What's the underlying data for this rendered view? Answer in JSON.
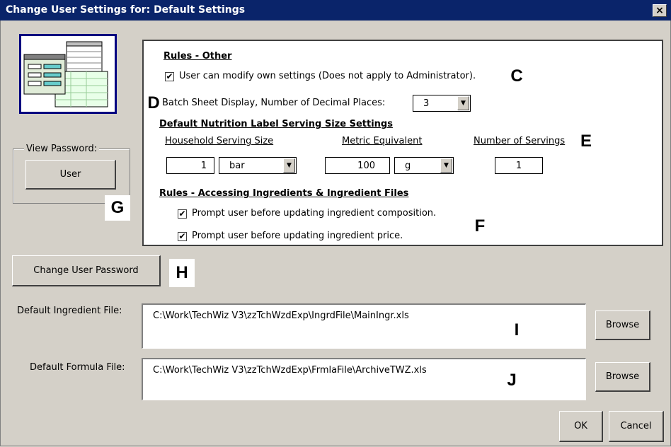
{
  "window": {
    "title": "Change User Settings for: Default Settings",
    "close_glyph": "×"
  },
  "view_password": {
    "label": "View Password:",
    "button": "User"
  },
  "rules_other": {
    "heading": "Rules - Other",
    "modify_settings_label": "User can modify own settings (Does not apply to Administrator).",
    "modify_settings_checked": true,
    "decimal_label": "Batch Sheet Display, Number of Decimal Places:",
    "decimal_value": "3"
  },
  "nutrition": {
    "heading": "Default Nutrition Label Serving Size Settings",
    "household_header": "Household Serving Size",
    "metric_header": "Metric Equivalent",
    "servings_header": "Number of Servings",
    "household_qty": "1",
    "household_unit": "bar",
    "metric_qty": "100",
    "metric_unit": "g",
    "servings": "1"
  },
  "ingredient_rules": {
    "heading": "Rules - Accessing Ingredients & Ingredient Files",
    "prompt_composition_label": "Prompt user before updating ingredient composition.",
    "prompt_composition_checked": true,
    "prompt_price_label": "Prompt user before updating ingredient price.",
    "prompt_price_checked": true
  },
  "change_password_button": "Change User Password",
  "files": {
    "ingredient_label": "Default Ingredient File:",
    "ingredient_path": "C:\\Work\\TechWiz V3\\zzTchWzdExp\\IngrdFile\\MainIngr.xls",
    "formula_label": "Default Formula File:",
    "formula_path": "C:\\Work\\TechWiz V3\\zzTchWzdExp\\FrmlaFile\\ArchiveTWZ.xls",
    "browse": "Browse"
  },
  "buttons": {
    "ok": "OK",
    "cancel": "Cancel"
  },
  "markers": {
    "c": "C",
    "d": "D",
    "e": "E",
    "f": "F",
    "g": "G",
    "h": "H",
    "i": "I",
    "j": "J"
  },
  "check_glyph": "✔",
  "arrow_glyph": "▼",
  "colors": {
    "titlebar": "#0a246a",
    "window": "#d4d0c8",
    "icon_border": "#000080"
  }
}
